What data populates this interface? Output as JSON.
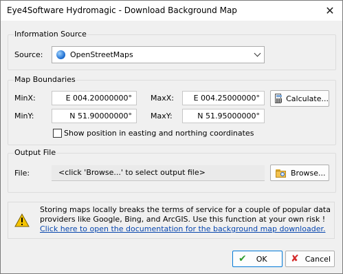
{
  "window": {
    "title": "Eye4Software Hydromagic - Download Background Map",
    "close_glyph": "✕"
  },
  "info_source": {
    "group_label": "Information Source",
    "source_label": "Source:",
    "source_value": "OpenStreetMaps"
  },
  "map_boundaries": {
    "group_label": "Map Boundaries",
    "minx_label": "MinX:",
    "minx_value": "E 004.20000000°",
    "maxx_label": "MaxX:",
    "maxx_value": "E 004.25000000°",
    "miny_label": "MinY:",
    "miny_value": "N 51.90000000°",
    "maxy_label": "MaxY:",
    "maxy_value": "N 51.95000000°",
    "calculate_label": "Calculate...",
    "easting_checkbox_label": "Show position in easting and northing coordinates",
    "easting_checked": false
  },
  "output_file": {
    "group_label": "Output File",
    "file_label": "File:",
    "file_placeholder": "<click 'Browse...' to select output file>",
    "browse_label": "Browse..."
  },
  "notice": {
    "line1": "Storing maps locally breaks the terms of service for a couple of popular data",
    "line2": "providers like Google, Bing, and ArcGIS. Use this function at your own risk !",
    "link_text": "Click here to open the documentation for the background map downloader."
  },
  "buttons": {
    "ok_label": "OK",
    "cancel_label": "Cancel"
  },
  "colors": {
    "ok_check": "#2e9d2e",
    "cancel_x": "#d42a2a",
    "link": "#0645ad",
    "warning": "#f5c400"
  }
}
